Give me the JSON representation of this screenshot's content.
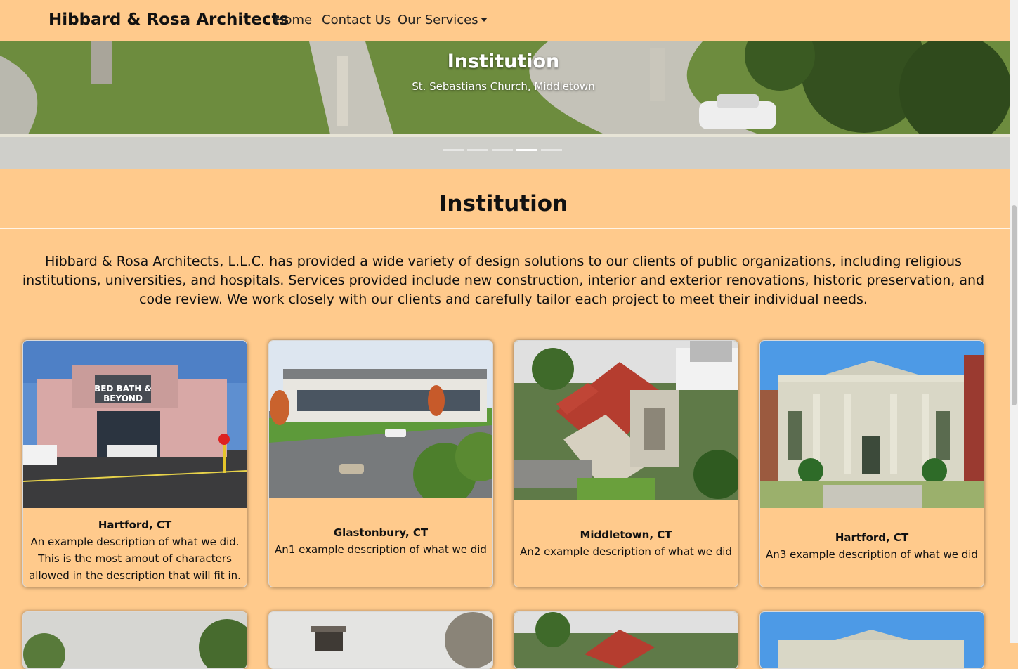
{
  "navbar": {
    "brand": "Hibbard & Rosa Architects",
    "links": [
      "Home",
      "Contact Us",
      "Our Services"
    ]
  },
  "hero": {
    "title": "Institution",
    "caption": "St. Sebastians Church, Middletown",
    "slide_count": 5,
    "active_slide": 4
  },
  "section": {
    "title": "Institution",
    "intro": "Hibbard & Rosa Architects, L.L.C. has provided a wide variety of design solutions to our clients of public organizations, including religious institutions, universities, and hospitals. Services provided include new construction, interior and exterior renovations, historic preservation, and code review. We work closely with our clients and carefully tailor each project to meet their individual needs."
  },
  "cards": [
    {
      "title": "Hartford, CT",
      "text": "An example description of what we did. This is the most amout of characters allowed in the description that will fit in."
    },
    {
      "title": "Glastonbury, CT",
      "text": "An1 example description of what we did"
    },
    {
      "title": "Middletown, CT",
      "text": "An2 example description of what we did"
    },
    {
      "title": "Hartford, CT",
      "text": "An3 example description of what we did"
    }
  ],
  "colors": {
    "background": "#ffca8c",
    "text": "#111111"
  }
}
